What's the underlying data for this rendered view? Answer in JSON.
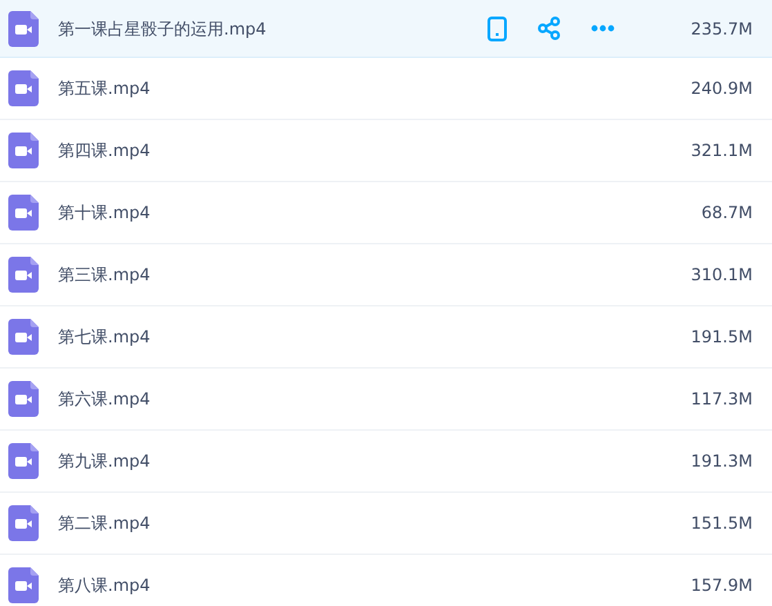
{
  "files": [
    {
      "name": "第一课占星骰子的运用.mp4",
      "size": "235.7M",
      "selected": true
    },
    {
      "name": "第五课.mp4",
      "size": "240.9M",
      "selected": false
    },
    {
      "name": "第四课.mp4",
      "size": "321.1M",
      "selected": false
    },
    {
      "name": "第十课.mp4",
      "size": "68.7M",
      "selected": false
    },
    {
      "name": "第三课.mp4",
      "size": "310.1M",
      "selected": false
    },
    {
      "name": "第七课.mp4",
      "size": "191.5M",
      "selected": false
    },
    {
      "name": "第六课.mp4",
      "size": "117.3M",
      "selected": false
    },
    {
      "name": "第九课.mp4",
      "size": "191.3M",
      "selected": false
    },
    {
      "name": "第二课.mp4",
      "size": "151.5M",
      "selected": false
    },
    {
      "name": "第八课.mp4",
      "size": "157.9M",
      "selected": false
    }
  ]
}
